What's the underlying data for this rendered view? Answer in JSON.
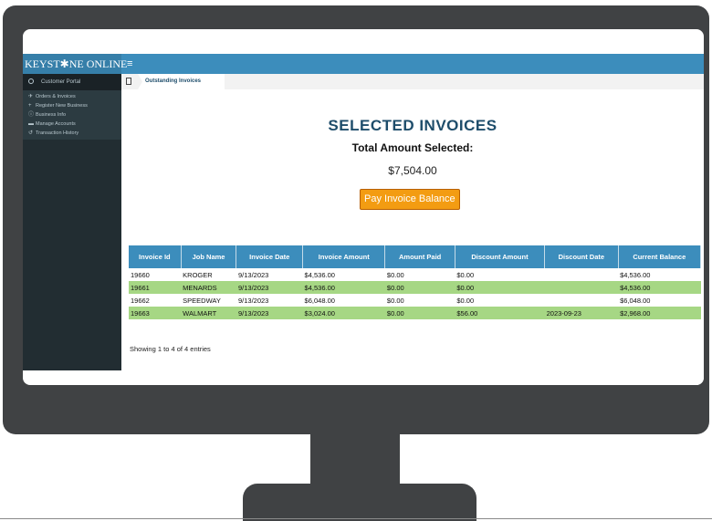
{
  "app": {
    "logo": "KEYST✱NE ONLINE",
    "menu_toggle": "≡"
  },
  "sidebar": {
    "header": "Customer Portal",
    "items": [
      {
        "icon": "rocket-icon",
        "glyph": "✈",
        "label": "Orders & Invoices"
      },
      {
        "icon": "plus-icon",
        "glyph": "+",
        "label": "Register New Business"
      },
      {
        "icon": "info-icon",
        "glyph": "ⓘ",
        "label": "Business Info"
      },
      {
        "icon": "card-icon",
        "glyph": "▬",
        "label": "Manage Accounts"
      },
      {
        "icon": "history-icon",
        "glyph": "↺",
        "label": "Transaction History"
      }
    ]
  },
  "breadcrumb": {
    "label": "Outstanding Invoices"
  },
  "main": {
    "title": "SELECTED INVOICES",
    "total_label": "Total Amount Selected:",
    "total_value": "$7,504.00",
    "pay_button": "Pay Invoice Balance"
  },
  "table": {
    "headers": [
      "Invoice Id",
      "Job Name",
      "Invoice Date",
      "Invoice Amount",
      "Amount Paid",
      "Discount Amount",
      "Discount Date",
      "Current Balance"
    ],
    "rows": [
      [
        "19660",
        "KROGER",
        "9/13/2023",
        "$4,536.00",
        "$0.00",
        "$0.00",
        "",
        "$4,536.00"
      ],
      [
        "19661",
        "MENARDS",
        "9/13/2023",
        "$4,536.00",
        "$0.00",
        "$0.00",
        "",
        "$4,536.00"
      ],
      [
        "19662",
        "SPEEDWAY",
        "9/13/2023",
        "$6,048.00",
        "$0.00",
        "$0.00",
        "",
        "$6,048.00"
      ],
      [
        "19663",
        "WALMART",
        "9/13/2023",
        "$3,024.00",
        "$0.00",
        "$56.00",
        "2023-09-23",
        "$2,968.00"
      ]
    ],
    "footer": "Showing 1 to 4 of 4 entries"
  },
  "colors": {
    "header_blue": "#3c8dbc",
    "title_navy": "#1e4d6b",
    "pay_orange": "#f39c12",
    "row_green": "#a6d784",
    "sidebar_dark": "#222d32",
    "monitor_gray": "#404244"
  }
}
